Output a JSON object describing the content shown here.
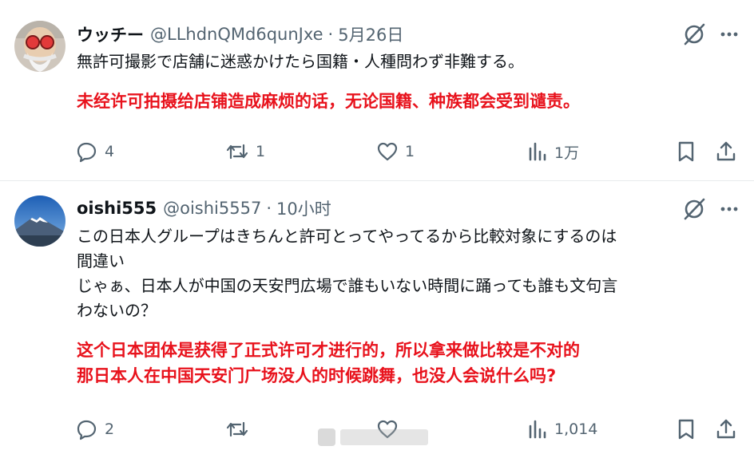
{
  "posts": [
    {
      "display_name": "ウッチー",
      "handle": "@LLhdnQMd6qunJxe",
      "separator": "·",
      "timestamp": "5月26日",
      "text_jp": "無許可撮影で店舗に迷惑かけたら国籍・人種問わず非難する。",
      "text_cn": "未经许可拍摄给店铺造成麻烦的话，无论国籍、种族都会受到谴责。",
      "stats": {
        "replies": "4",
        "reposts": "1",
        "likes": "1",
        "views": "1万"
      }
    },
    {
      "display_name": "oishi555",
      "handle": "@oishi5557",
      "separator": "·",
      "timestamp": "10小时",
      "text_jp_lines": [
        "この日本人グループはきちんと許可とってやってるから比較対象にするのは",
        "間違い",
        "じゃぁ、日本人が中国の天安門広場で誰もいない時間に踊っても誰も文句言",
        "わないの？"
      ],
      "text_cn_lines": [
        "这个日本团体是获得了正式许可才进行的，所以拿来做比较是不对的",
        "那日本人在中国天安门广场没人的时候跳舞，也没人会说什么吗?"
      ],
      "stats": {
        "replies": "2",
        "reposts": "",
        "likes": "",
        "views": "1,014"
      }
    }
  ],
  "icons": {
    "grok": "grok-slash-circle-icon",
    "more": "more-dots-icon",
    "reply": "reply-bubble-icon",
    "repost": "repost-arrows-icon",
    "like": "heart-icon",
    "views": "views-bars-icon",
    "bookmark": "bookmark-icon",
    "share": "share-upload-icon"
  },
  "colors": {
    "text_primary": "#0f1419",
    "text_secondary": "#536471",
    "translation_red": "#e8121c",
    "divider": "#eff3f4"
  }
}
